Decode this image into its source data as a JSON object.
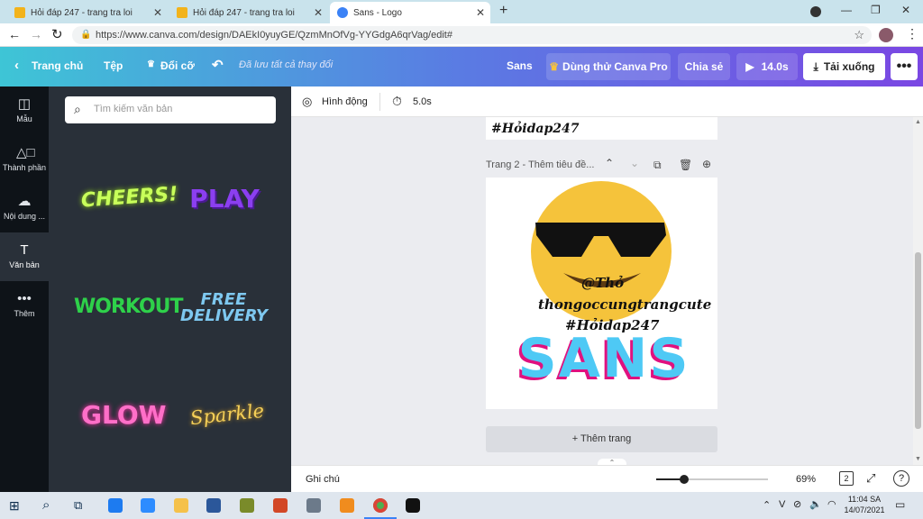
{
  "browser": {
    "tabs": [
      {
        "title": "Hỏi đáp 247 - trang tra loi",
        "favicon_color": "#f2b31b"
      },
      {
        "title": "Hỏi đáp 247 - trang tra loi",
        "favicon_color": "#f2b31b"
      },
      {
        "title": "Sans - Logo",
        "favicon_color": "#3b82f6"
      }
    ],
    "url": "https://www.canva.com/design/DAEkI0yuyGE/QzmMnOfVg-YYGdgA6qrVag/edit#"
  },
  "header": {
    "home": "Trang chủ",
    "file": "Tệp",
    "resize": "Đổi cỡ",
    "saved": "Đã lưu tất cả thay đổi",
    "design_name": "Sans",
    "pro": "Dùng thử Canva Pro",
    "share": "Chia sẻ",
    "duration": "14.0s",
    "download": "Tải xuống"
  },
  "rail": [
    {
      "label": "Mẫu",
      "icon": "layout-icon"
    },
    {
      "label": "Thành phần",
      "icon": "shapes-icon"
    },
    {
      "label": "Nội dung ...",
      "icon": "upload-cloud-icon"
    },
    {
      "label": "Văn bản",
      "icon": "text-icon"
    },
    {
      "label": "Thêm",
      "icon": "more-icon"
    }
  ],
  "panel": {
    "search_placeholder": "Tìm kiếm văn bản",
    "stickers": [
      "CHEERS!",
      "PLAY",
      "WORKOUT",
      "FREE DELIVERY",
      "GLOW",
      "Sparkle"
    ]
  },
  "toolbar": {
    "animate": "Hình động",
    "duration": "5.0s"
  },
  "page1": {
    "text": "#Hỏidap247"
  },
  "page2": {
    "label": "Trang 2 - Thêm tiêu đề...",
    "tag_text": "@Thỏ",
    "handle_text": "thongoccungtrangcute",
    "hashtag_text": "#Hỏidap247",
    "title": "SANS"
  },
  "add_page": "+ Thêm trang",
  "footer": {
    "notes": "Ghi chú",
    "zoom": "69%",
    "page_count": "2",
    "zoom_level": 0.25
  },
  "taskbar": {
    "time": "11:04 SA",
    "date": "14/07/2021",
    "lang": "V"
  },
  "colors": {
    "accent_purple": "#7a47e3",
    "accent_cyan": "#3ec5d6",
    "dark_panel": "#293039",
    "sans_blue": "#4ec9f5",
    "sans_pink": "#e0117f"
  }
}
